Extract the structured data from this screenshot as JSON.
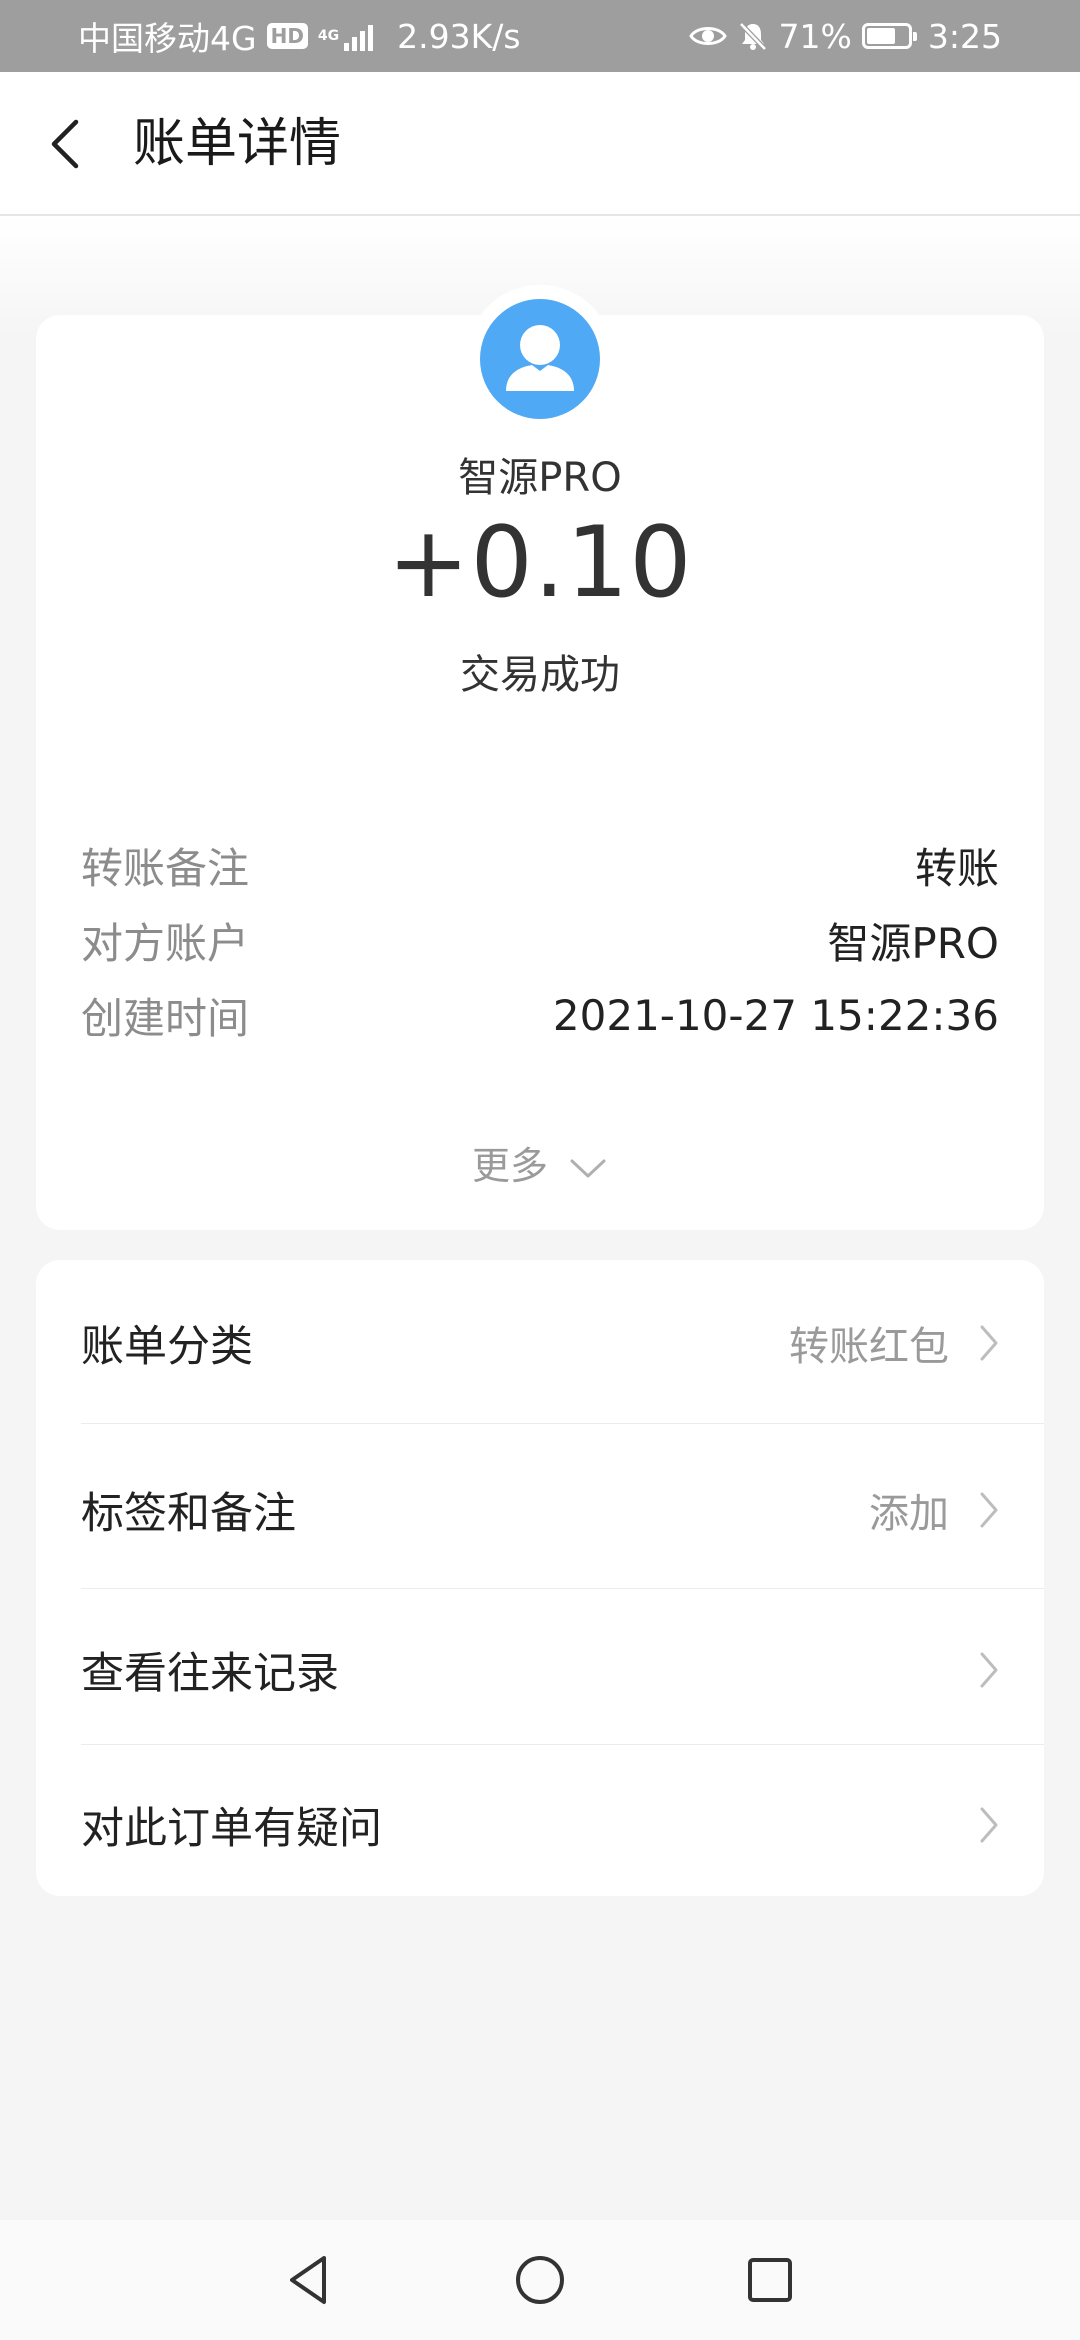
{
  "status_bar": {
    "carrier": "中国移动4G",
    "hd": "HD",
    "network_tech": "4G",
    "speed": "2.93K/s",
    "battery": "71%",
    "battery_level": 0.71,
    "time": "3:25",
    "icons": [
      "eye-icon",
      "bell-mute-icon",
      "battery-icon",
      "signal-icon"
    ]
  },
  "header": {
    "title": "账单详情",
    "back_icon": "chevron-left-icon"
  },
  "transaction": {
    "payee": "智源PRO",
    "amount": "+0.10",
    "status": "交易成功",
    "avatar_icon": "user-icon",
    "avatar_color": "#4fa9f5",
    "details": [
      {
        "label": "转账备注",
        "value": "转账"
      },
      {
        "label": "对方账户",
        "value": "智源PRO"
      },
      {
        "label": "创建时间",
        "value": "2021-10-27 15:22:36"
      }
    ],
    "more_label": "更多"
  },
  "menu": [
    {
      "label": "账单分类",
      "value": "转账红包"
    },
    {
      "label": "标签和备注",
      "value": "添加"
    },
    {
      "label": "查看往来记录",
      "value": ""
    },
    {
      "label": "对此订单有疑问",
      "value": ""
    }
  ],
  "nav_bar": {
    "icons": [
      "back-triangle-icon",
      "home-circle-icon",
      "recents-square-icon"
    ]
  }
}
